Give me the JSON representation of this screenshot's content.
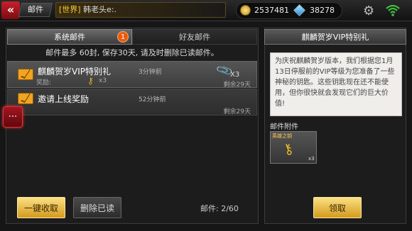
{
  "header": {
    "title": "邮件",
    "chat_channel": "[世界]",
    "chat_text": "韩老头e:.",
    "gold": "2537481",
    "diamond": "38278"
  },
  "tabs": [
    {
      "label": "系统邮件",
      "badge": "1"
    },
    {
      "label": "好友邮件"
    }
  ],
  "mail_info": "邮件最多 60封, 保存30天, 请及时删除已读邮件。",
  "mails": [
    {
      "title": "麒麟贺岁VIP特别礼",
      "time": "3分钟前",
      "sub": "奖励:",
      "item_count": "x3",
      "attach_count": "X3",
      "remaining": "剩余29天"
    },
    {
      "title": "邀请上线奖励",
      "time": "52分钟前",
      "remaining": "剩余29天"
    }
  ],
  "buttons": {
    "collect_all": "一键收取",
    "delete_read": "删除已读",
    "claim": "领取"
  },
  "mail_count": "邮件: 2/60",
  "detail": {
    "title": "麒麟贺岁VIP特别礼",
    "body": "为庆祝麒麟贺岁版本，我们根据您1月13日停服前的VIP等级为您准备了一些神秘的钥匙。这些钥匙现在还不能使用，但你很快就会发现它们的巨大价值!",
    "attach_label": "邮件附件",
    "attach_item_name": "英雄之钥",
    "attach_item_count": "x3"
  },
  "colors": {
    "accent": "#f2a420",
    "brand_red": "#c8202a",
    "badge": "#e85a10"
  }
}
